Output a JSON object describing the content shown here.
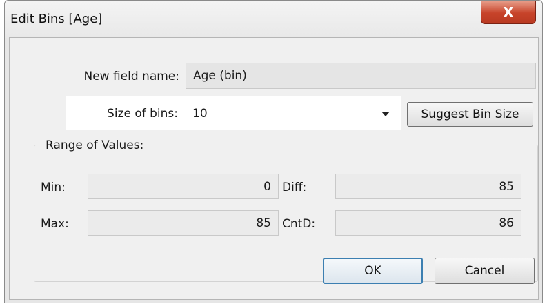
{
  "window": {
    "title": "Edit Bins [Age]",
    "close_glyph": "X"
  },
  "form": {
    "new_field_name": {
      "label": "New field name:",
      "value": "Age (bin)"
    },
    "size_of_bins": {
      "label": "Size of bins:",
      "value": "10",
      "dropdown_icon": "chevron-down-icon"
    },
    "suggest_button": "Suggest Bin Size"
  },
  "range": {
    "title": "Range of Values:",
    "min": {
      "label": "Min:",
      "value": "0"
    },
    "max": {
      "label": "Max:",
      "value": "85"
    },
    "diff": {
      "label": "Diff:",
      "value": "85"
    },
    "cntd": {
      "label": "CntD:",
      "value": "86"
    }
  },
  "buttons": {
    "ok": "OK",
    "cancel": "Cancel"
  },
  "colors": {
    "close_button": "#c7432a",
    "default_button_border": "#3c7fb1",
    "dialog_background": "#f0f0f0"
  }
}
